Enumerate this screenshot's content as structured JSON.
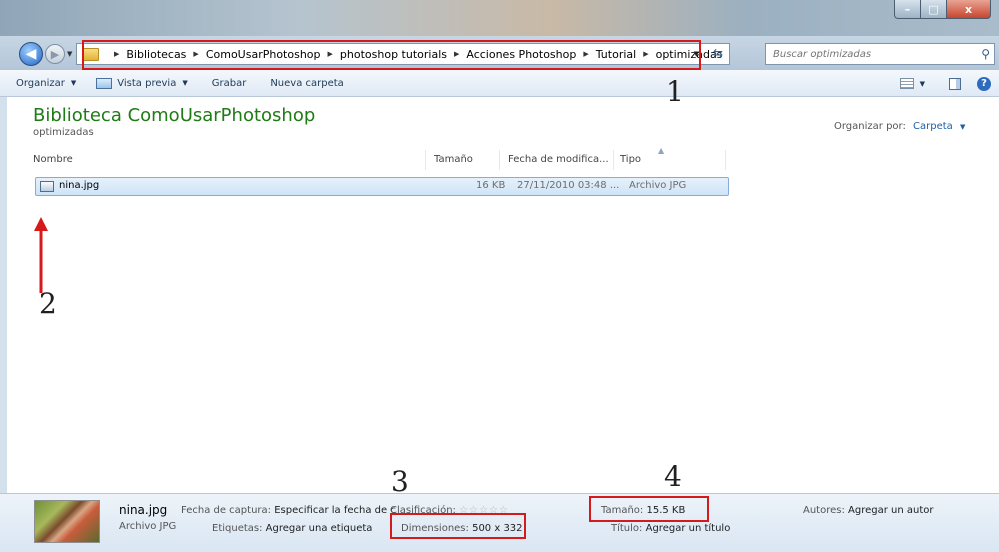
{
  "window": {
    "controls": {
      "minimize": "–",
      "maximize": "□",
      "close": "x"
    }
  },
  "nav": {
    "back_icon": "back-arrow-icon",
    "forward_icon": "forward-arrow-icon",
    "breadcrumbs": [
      "Bibliotecas",
      "ComoUsarPhotoshop",
      "photoshop tutorials",
      "Acciones Photoshop",
      "Tutorial",
      "optimizadas"
    ],
    "search_placeholder": "Buscar optimizadas"
  },
  "toolbar": {
    "organize": "Organizar",
    "preview": "Vista previa",
    "burn": "Grabar",
    "new_folder": "Nueva carpeta"
  },
  "library": {
    "title": "Biblioteca ComoUsarPhotoshop",
    "subtitle": "optimizadas",
    "arrange_label": "Organizar por:",
    "arrange_value": "Carpeta"
  },
  "columns": [
    "Nombre",
    "Tamaño",
    "Fecha de modifica...",
    "Tipo"
  ],
  "files": [
    {
      "name": "nina.jpg",
      "size": "16 KB",
      "date": "27/11/2010 03:48 ...",
      "type": "Archivo JPG"
    }
  ],
  "annotations": [
    "1",
    "2",
    "3",
    "4"
  ],
  "details": {
    "name": "nina.jpg",
    "type": "Archivo JPG",
    "capture_label": "Fecha de captura:",
    "capture_value": "Especificar la fecha de c",
    "rating_label": "Clasificación:",
    "tags_label": "Etiquetas:",
    "tags_value": "Agregar una etiqueta",
    "dims_label": "Dimensiones:",
    "dims_value": "500 x 332",
    "size_label": "Tamaño:",
    "size_value": "15.5 KB",
    "title_label": "Título:",
    "title_value": "Agregar un título",
    "authors_label": "Autores:",
    "authors_value": "Agregar un autor"
  },
  "colors": {
    "highlight_box": "#d41a1a",
    "library_title": "#1e7b15",
    "selection": "#cfe4f7"
  }
}
